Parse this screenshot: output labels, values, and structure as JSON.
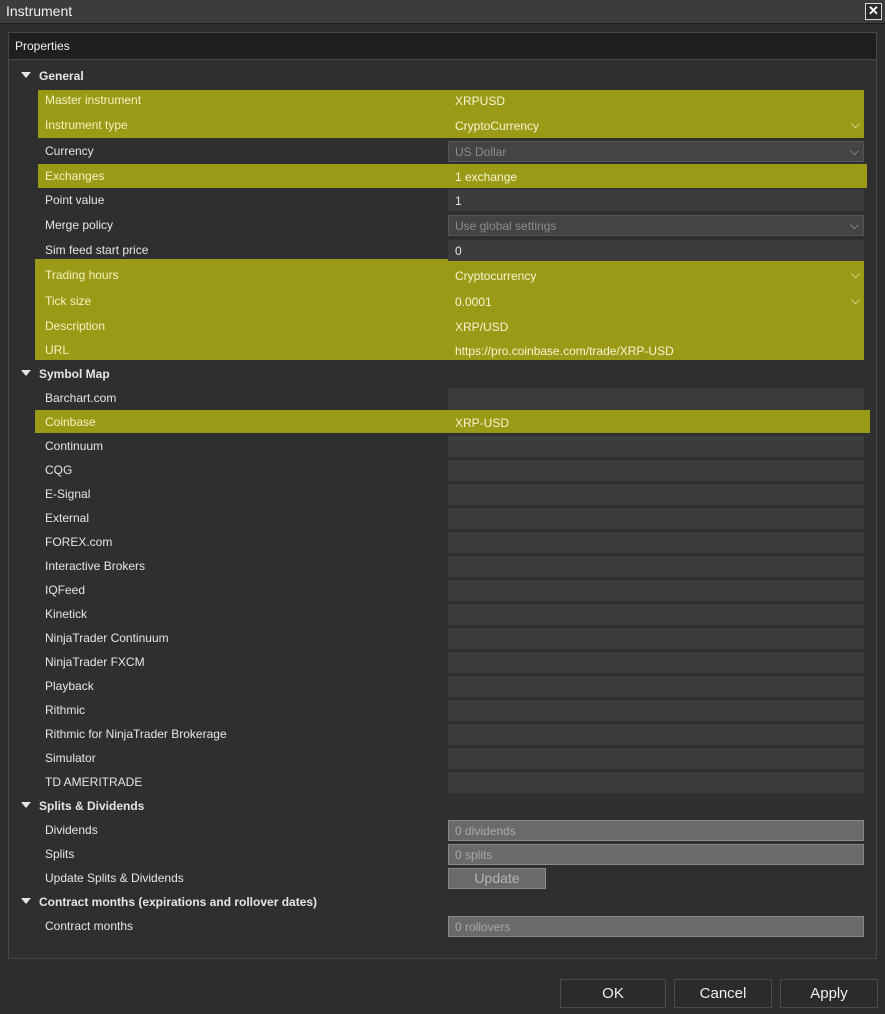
{
  "window": {
    "title": "Instrument"
  },
  "panel": {
    "header": "Properties"
  },
  "general": {
    "title": "General",
    "master_instrument": {
      "label": "Master instrument",
      "value": "XRPUSD"
    },
    "instrument_type": {
      "label": "Instrument type",
      "value": "CryptoCurrency"
    },
    "currency": {
      "label": "Currency",
      "value": "US Dollar"
    },
    "exchanges": {
      "label": "Exchanges",
      "value": "1 exchange"
    },
    "point_value": {
      "label": "Point value",
      "value": "1"
    },
    "merge_policy": {
      "label": "Merge policy",
      "value": "Use global settings"
    },
    "sim_feed_start_price": {
      "label": "Sim feed start price",
      "value": "0"
    },
    "trading_hours": {
      "label": "Trading hours",
      "value": "Cryptocurrency"
    },
    "tick_size": {
      "label": "Tick size",
      "value": "0.0001"
    },
    "description": {
      "label": "Description",
      "value": "XRP/USD"
    },
    "url": {
      "label": "URL",
      "value": "https://pro.coinbase.com/trade/XRP-USD"
    }
  },
  "symbol_map": {
    "title": "Symbol Map",
    "items": [
      {
        "label": "Barchart.com",
        "value": ""
      },
      {
        "label": "Coinbase",
        "value": "XRP-USD"
      },
      {
        "label": "Continuum",
        "value": ""
      },
      {
        "label": "CQG",
        "value": ""
      },
      {
        "label": "E-Signal",
        "value": ""
      },
      {
        "label": "External",
        "value": ""
      },
      {
        "label": "FOREX.com",
        "value": ""
      },
      {
        "label": "Interactive Brokers",
        "value": ""
      },
      {
        "label": "IQFeed",
        "value": ""
      },
      {
        "label": "Kinetick",
        "value": ""
      },
      {
        "label": "NinjaTrader Continuum",
        "value": ""
      },
      {
        "label": "NinjaTrader FXCM",
        "value": ""
      },
      {
        "label": "Playback",
        "value": ""
      },
      {
        "label": "Rithmic",
        "value": ""
      },
      {
        "label": "Rithmic for NinjaTrader Brokerage",
        "value": ""
      },
      {
        "label": "Simulator",
        "value": ""
      },
      {
        "label": "TD AMERITRADE",
        "value": ""
      }
    ]
  },
  "splits": {
    "title": "Splits & Dividends",
    "dividends": {
      "label": "Dividends",
      "value": "0 dividends"
    },
    "splits": {
      "label": "Splits",
      "value": "0 splits"
    },
    "update": {
      "label": "Update Splits & Dividends",
      "button": "Update"
    }
  },
  "contract": {
    "title": "Contract months (expirations and rollover dates)",
    "months": {
      "label": "Contract months",
      "value": "0 rollovers"
    }
  },
  "footer": {
    "ok": "OK",
    "cancel": "Cancel",
    "apply": "Apply"
  },
  "colors": {
    "highlight": "#9a9a17",
    "background": "#2d2d2d",
    "field": "#3c3c3c"
  },
  "icons": {
    "collapse": "triangle-down-icon",
    "dropdown": "chevron-down-icon",
    "close": "close-icon"
  }
}
